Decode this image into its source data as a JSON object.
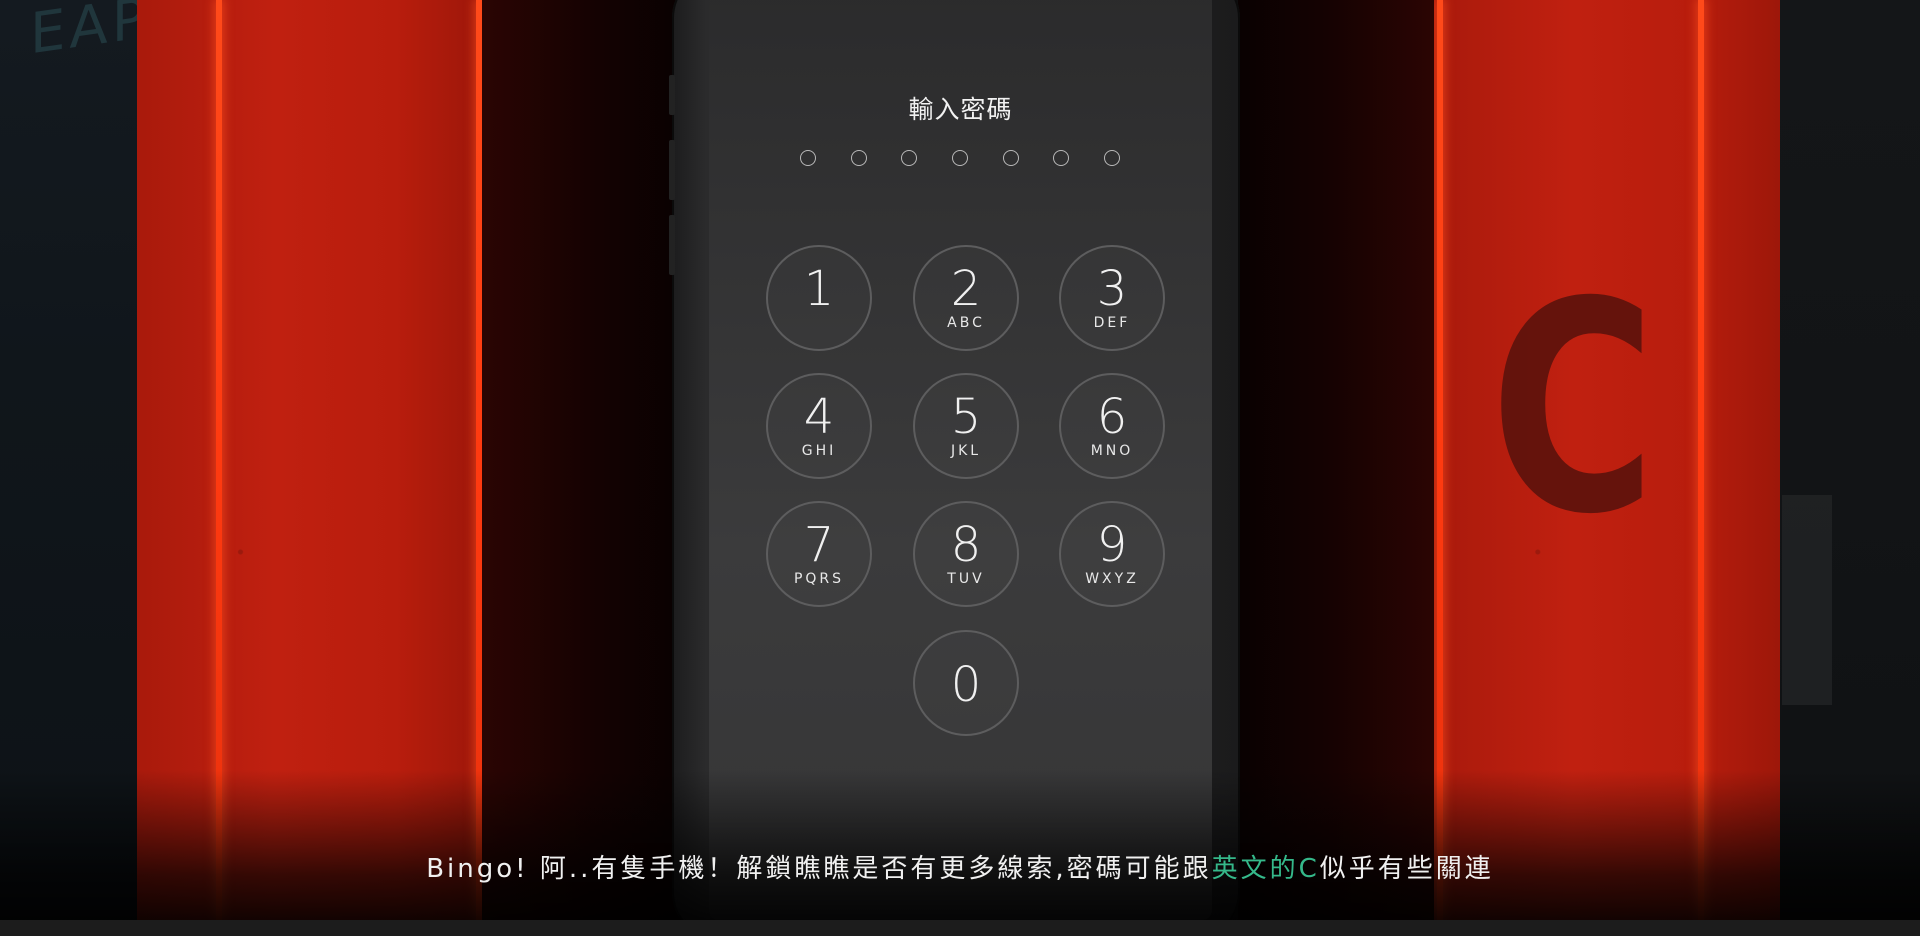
{
  "scene": {
    "door_letter": "C",
    "accent_red": "#c02010",
    "glow": "#ff4a1a"
  },
  "lockscreen": {
    "title": "輸入密碼",
    "passcode_length": 7,
    "keys": [
      {
        "digit": "1",
        "letters": ""
      },
      {
        "digit": "2",
        "letters": "ABC"
      },
      {
        "digit": "3",
        "letters": "DEF"
      },
      {
        "digit": "4",
        "letters": "GHI"
      },
      {
        "digit": "5",
        "letters": "JKL"
      },
      {
        "digit": "6",
        "letters": "MNO"
      },
      {
        "digit": "7",
        "letters": "PQRS"
      },
      {
        "digit": "8",
        "letters": "TUV"
      },
      {
        "digit": "9",
        "letters": "WXYZ"
      },
      {
        "digit": "0",
        "letters": ""
      }
    ]
  },
  "subtitle": {
    "before": "Bingo! 阿..有隻手機！解鎖瞧瞧是否有更多線索,密碼可能跟",
    "highlight": "英文的C",
    "after": "似乎有些關連",
    "highlight_color": "#35b88a"
  }
}
